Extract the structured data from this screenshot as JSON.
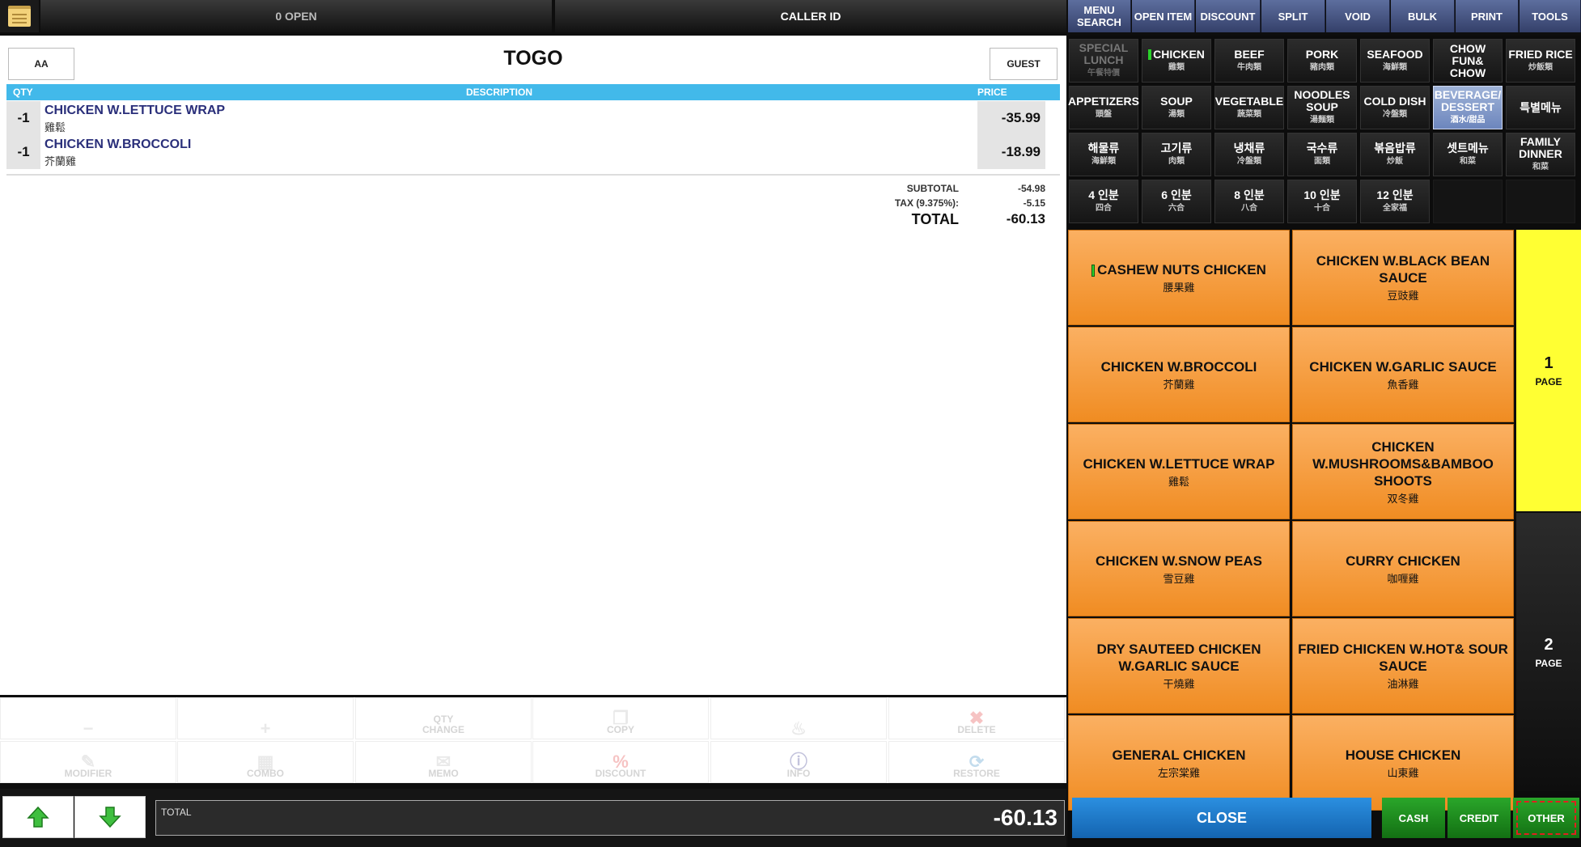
{
  "topbar": {
    "open_label": "0 OPEN",
    "caller_label": "CALLER ID"
  },
  "tools": [
    "MENU SEARCH",
    "OPEN ITEM",
    "DISCOUNT",
    "SPLIT",
    "VOID",
    "BULK",
    "PRINT",
    "TOOLS"
  ],
  "order": {
    "left_button": "AA",
    "title": "TOGO",
    "guest_button": "GUEST",
    "headers": {
      "qty": "QTY",
      "description": "DESCRIPTION",
      "price": "PRICE"
    },
    "lines": [
      {
        "qty": "-1",
        "name": "CHICKEN W.LETTUCE WRAP",
        "sub": "雞鬆",
        "price": "-35.99"
      },
      {
        "qty": "-1",
        "name": "CHICKEN W.BROCCOLI",
        "sub": "芥蘭雞",
        "price": "-18.99"
      }
    ],
    "subtotal_label": "SUBTOTAL",
    "subtotal": "-54.98",
    "tax_label": "TAX (9.375%):",
    "tax": "-5.15",
    "total_label": "TOTAL",
    "total": "-60.13"
  },
  "actions": [
    {
      "icon": "−",
      "label": ""
    },
    {
      "icon": "+",
      "label": ""
    },
    {
      "icon": "",
      "label": "QTY CHANGE"
    },
    {
      "icon": "❐",
      "label": "COPY"
    },
    {
      "icon": "♨",
      "label": ""
    },
    {
      "icon": "✖",
      "label": "DELETE"
    },
    {
      "icon": "✎",
      "label": "MODIFIER"
    },
    {
      "icon": "▦",
      "label": "COMBO"
    },
    {
      "icon": "✉",
      "label": "MEMO"
    },
    {
      "icon": "%",
      "label": "DISCOUNT"
    },
    {
      "icon": "ⓘ",
      "label": "INFO"
    },
    {
      "icon": "⟳",
      "label": "RESTORE"
    }
  ],
  "bottom": {
    "total_label": "TOTAL",
    "total_value": "-60.13"
  },
  "categories": [
    {
      "name": "SPECIAL LUNCH",
      "sub": "午餐特價",
      "state": "disabled"
    },
    {
      "name": "CHICKEN",
      "sub": "雞類",
      "state": "marked"
    },
    {
      "name": "BEEF",
      "sub": "牛肉類",
      "state": ""
    },
    {
      "name": "PORK",
      "sub": "豬肉類",
      "state": ""
    },
    {
      "name": "SEAFOOD",
      "sub": "海鮮類",
      "state": ""
    },
    {
      "name": "CHOW FUN& CHOW",
      "sub": "",
      "state": ""
    },
    {
      "name": "FRIED RICE",
      "sub": "炒飯類",
      "state": ""
    },
    {
      "name": "APPETIZERS",
      "sub": "頭盤",
      "state": ""
    },
    {
      "name": "SOUP",
      "sub": "湯類",
      "state": ""
    },
    {
      "name": "VEGETABLE",
      "sub": "蔬菜類",
      "state": ""
    },
    {
      "name": "NOODLES SOUP",
      "sub": "湯麵類",
      "state": ""
    },
    {
      "name": "COLD DISH",
      "sub": "冷盤類",
      "state": ""
    },
    {
      "name": "BEVERAGE/ DESSERT",
      "sub": "酒水/甜品",
      "state": "active"
    },
    {
      "name": "특별메뉴",
      "sub": "",
      "state": ""
    },
    {
      "name": "해물류",
      "sub": "海鮮類",
      "state": ""
    },
    {
      "name": "고기류",
      "sub": "肉類",
      "state": ""
    },
    {
      "name": "냉채류",
      "sub": "冷盤類",
      "state": ""
    },
    {
      "name": "국수류",
      "sub": "面類",
      "state": ""
    },
    {
      "name": "볶음밥류",
      "sub": "炒飯",
      "state": ""
    },
    {
      "name": "셋트메뉴",
      "sub": "和菜",
      "state": ""
    },
    {
      "name": "FAMILY DINNER",
      "sub": "和菜",
      "state": ""
    },
    {
      "name": "4 인분",
      "sub": "四合",
      "state": ""
    },
    {
      "name": "6 인분",
      "sub": "六合",
      "state": ""
    },
    {
      "name": "8 인분",
      "sub": "八合",
      "state": ""
    },
    {
      "name": "10 인분",
      "sub": "十合",
      "state": ""
    },
    {
      "name": "12 인분",
      "sub": "全家福",
      "state": ""
    },
    {
      "name": "",
      "sub": "",
      "state": "empty"
    },
    {
      "name": "",
      "sub": "",
      "state": "empty"
    }
  ],
  "items": [
    {
      "name": "CASHEW NUTS CHICKEN",
      "sub": "腰果雞",
      "marked": true
    },
    {
      "name": "CHICKEN W.BLACK BEAN SAUCE",
      "sub": "豆豉雞",
      "marked": false
    },
    {
      "name": "CHICKEN W.BROCCOLI",
      "sub": "芥蘭雞",
      "marked": false
    },
    {
      "name": "CHICKEN W.GARLIC SAUCE",
      "sub": "魚香雞",
      "marked": false
    },
    {
      "name": "CHICKEN W.LETTUCE WRAP",
      "sub": "雞鬆",
      "marked": false
    },
    {
      "name": "CHICKEN W.MUSHROOMS&BAMBOO SHOOTS",
      "sub": "双冬雞",
      "marked": false
    },
    {
      "name": "CHICKEN W.SNOW PEAS",
      "sub": "雪豆雞",
      "marked": false
    },
    {
      "name": "CURRY CHICKEN",
      "sub": "咖喱雞",
      "marked": false
    },
    {
      "name": "DRY SAUTEED CHICKEN W.GARLIC SAUCE",
      "sub": "干燒雞",
      "marked": false
    },
    {
      "name": "FRIED CHICKEN W.HOT& SOUR SAUCE",
      "sub": "油淋雞",
      "marked": false
    },
    {
      "name": "GENERAL CHICKEN",
      "sub": "左宗棠雞",
      "marked": false
    },
    {
      "name": "HOUSE CHICKEN",
      "sub": "山東雞",
      "marked": false
    }
  ],
  "pages": [
    {
      "num": "1",
      "label": "PAGE"
    },
    {
      "num": "2",
      "label": "PAGE"
    }
  ],
  "pay": {
    "close": "CLOSE",
    "cash": "CASH",
    "credit": "CREDIT",
    "other": "OTHER"
  },
  "colors": {
    "header_blue": "#42b9ea",
    "item_orange": "#f59a34",
    "page_yellow": "#ffff33",
    "close_blue": "#1c77c8",
    "pay_green": "#1f8f1f"
  }
}
